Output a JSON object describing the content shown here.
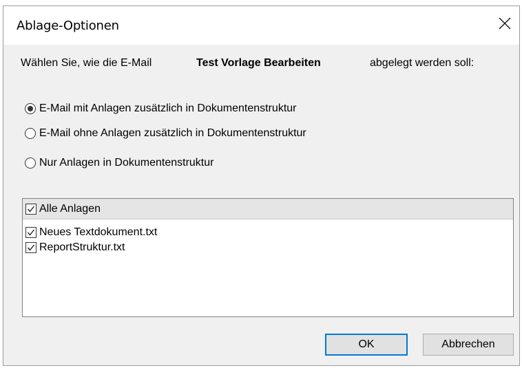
{
  "dialog": {
    "title": "Ablage-Optionen",
    "close_icon": "close-icon"
  },
  "prompt": {
    "before": "Wählen Sie, wie die E-Mail",
    "subject": "Test Vorlage Bearbeiten",
    "after": "abgelegt werden soll:"
  },
  "options": [
    {
      "label": "E-Mail mit Anlagen zusätzlich in Dokumentenstruktur",
      "selected": true
    },
    {
      "label": "E-Mail ohne Anlagen zusätzlich in Dokumentenstruktur",
      "selected": false
    },
    {
      "label": "Nur Anlagen in Dokumentenstruktur",
      "selected": false
    }
  ],
  "attachments": {
    "header_label": "Alle Anlagen",
    "header_checked": true,
    "items": [
      {
        "label": "Neues Textdokument.txt",
        "checked": true
      },
      {
        "label": "ReportStruktur.txt",
        "checked": true
      }
    ]
  },
  "buttons": {
    "ok_label": "OK",
    "cancel_label": "Abbrechen"
  },
  "colors": {
    "accent": "#0078d7",
    "dialog_bg": "#f0f0f0"
  }
}
